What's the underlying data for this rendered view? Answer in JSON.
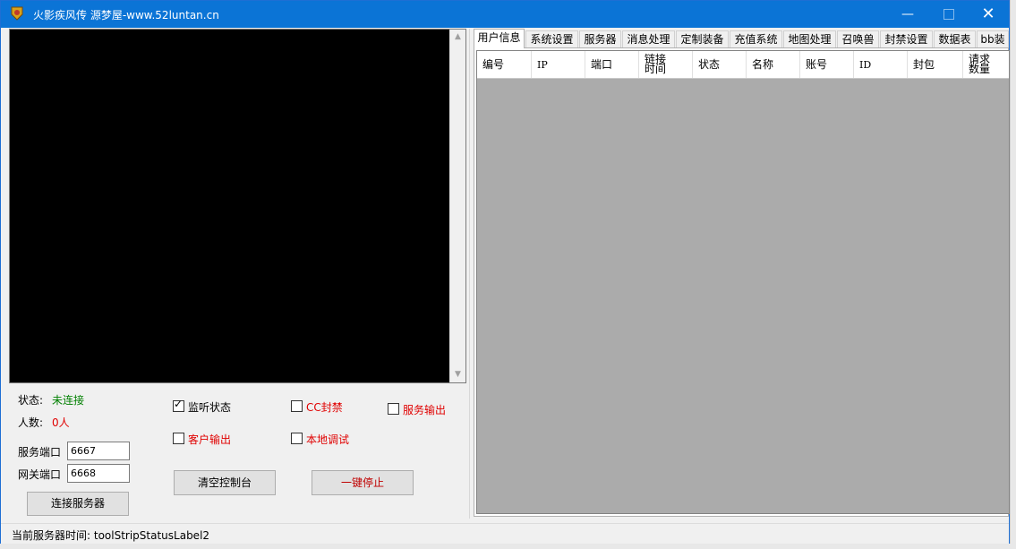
{
  "window": {
    "title": "火影疾风传  源梦屋-www.52luntan.cn",
    "minimize_glyph": "—",
    "close_glyph": "✕"
  },
  "left": {
    "status_label": "状态:",
    "status_value": "未连接",
    "count_label": "人数:",
    "count_value": "0人",
    "server_port_label": "服务端口",
    "server_port_value": "6667",
    "gateway_port_label": "网关端口",
    "gateway_port_value": "6668",
    "connect_button": "连接服务器",
    "checkboxes": {
      "listen": {
        "label": "监听状态",
        "checked": true
      },
      "cc_ban": {
        "label": "CC封禁",
        "checked": false
      },
      "server_output": {
        "label": "服务输出",
        "checked": false
      },
      "client_output": {
        "label": "客户输出",
        "checked": false
      },
      "local_debug": {
        "label": "本地调试",
        "checked": false
      }
    },
    "clear_console_button": "清空控制台",
    "stop_all_button": "一键停止"
  },
  "tabs": [
    "用户信息",
    "系统设置",
    "服务器",
    "消息处理",
    "定制装备",
    "充值系统",
    "地图处理",
    "召唤兽",
    "封禁设置",
    "数据表",
    "bb装"
  ],
  "active_tab": "用户信息",
  "grid": {
    "columns": [
      "编号",
      "IP",
      "端口",
      "链接\n时间",
      "状态",
      "名称",
      "账号",
      "ID",
      "封包",
      "请求\n数量"
    ]
  },
  "statusbar": {
    "text": "当前服务器时间:  toolStripStatusLabel2"
  },
  "colors": {
    "titlebar": "#0b74d6",
    "status_ok": "#008000",
    "status_warn": "#e00000",
    "grid_bg": "#ababab"
  }
}
